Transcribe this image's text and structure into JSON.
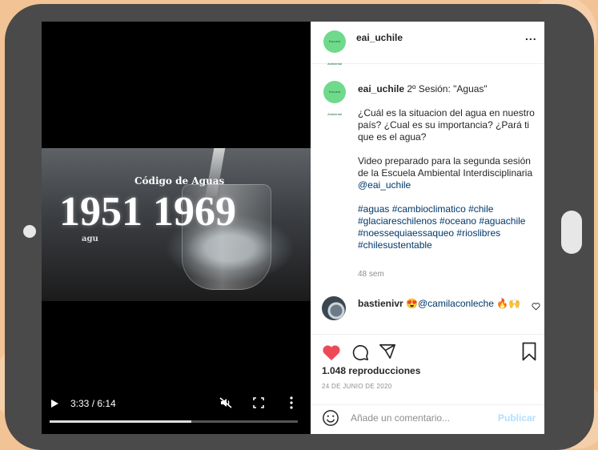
{
  "video": {
    "overlay_top": "Código de Aguas",
    "overlay_years": "1951  1969",
    "overlay_bottom": "agu",
    "time": "3:33 / 6:14",
    "progress_fraction": 0.57
  },
  "post": {
    "username": "eai_uchile",
    "avatar_text": "Escuela Ambiental",
    "more": "...",
    "caption_user": "eai_uchile",
    "caption_title": "2º Sesión: \"Aguas\"",
    "caption_p1": "¿Cuál es la situacion del agua en nuestro país? ¿Cual es su importancia? ¿Pará ti que es el agua?",
    "caption_p2_text": "Video preparado para la segunda sesión de la Escuela Ambiental Interdisciplinaria ",
    "caption_p2_mention": "@eai_uchile",
    "hashtags": "#aguas #cambioclimatico #chile #glaciareschilenos #oceano #aguachile #noessequiaessaqueo #rioslibres #chilesustentable",
    "ago": "48 sem"
  },
  "comment": {
    "user": "bastienivr",
    "emoji_1": "😍",
    "mention": "@camilaconleche",
    "emoji_2": "🔥🙌"
  },
  "stats": {
    "views": "1.048 reproducciones",
    "date": "24 DE JUNIO DE 2020"
  },
  "add_comment": {
    "placeholder": "Añade un comentario...",
    "post_label": "Publicar"
  },
  "colors": {
    "like": "#ed4956",
    "link": "#00376b",
    "publish_disabled": "#b2dffc",
    "avatar_green": "#6fd98c"
  }
}
